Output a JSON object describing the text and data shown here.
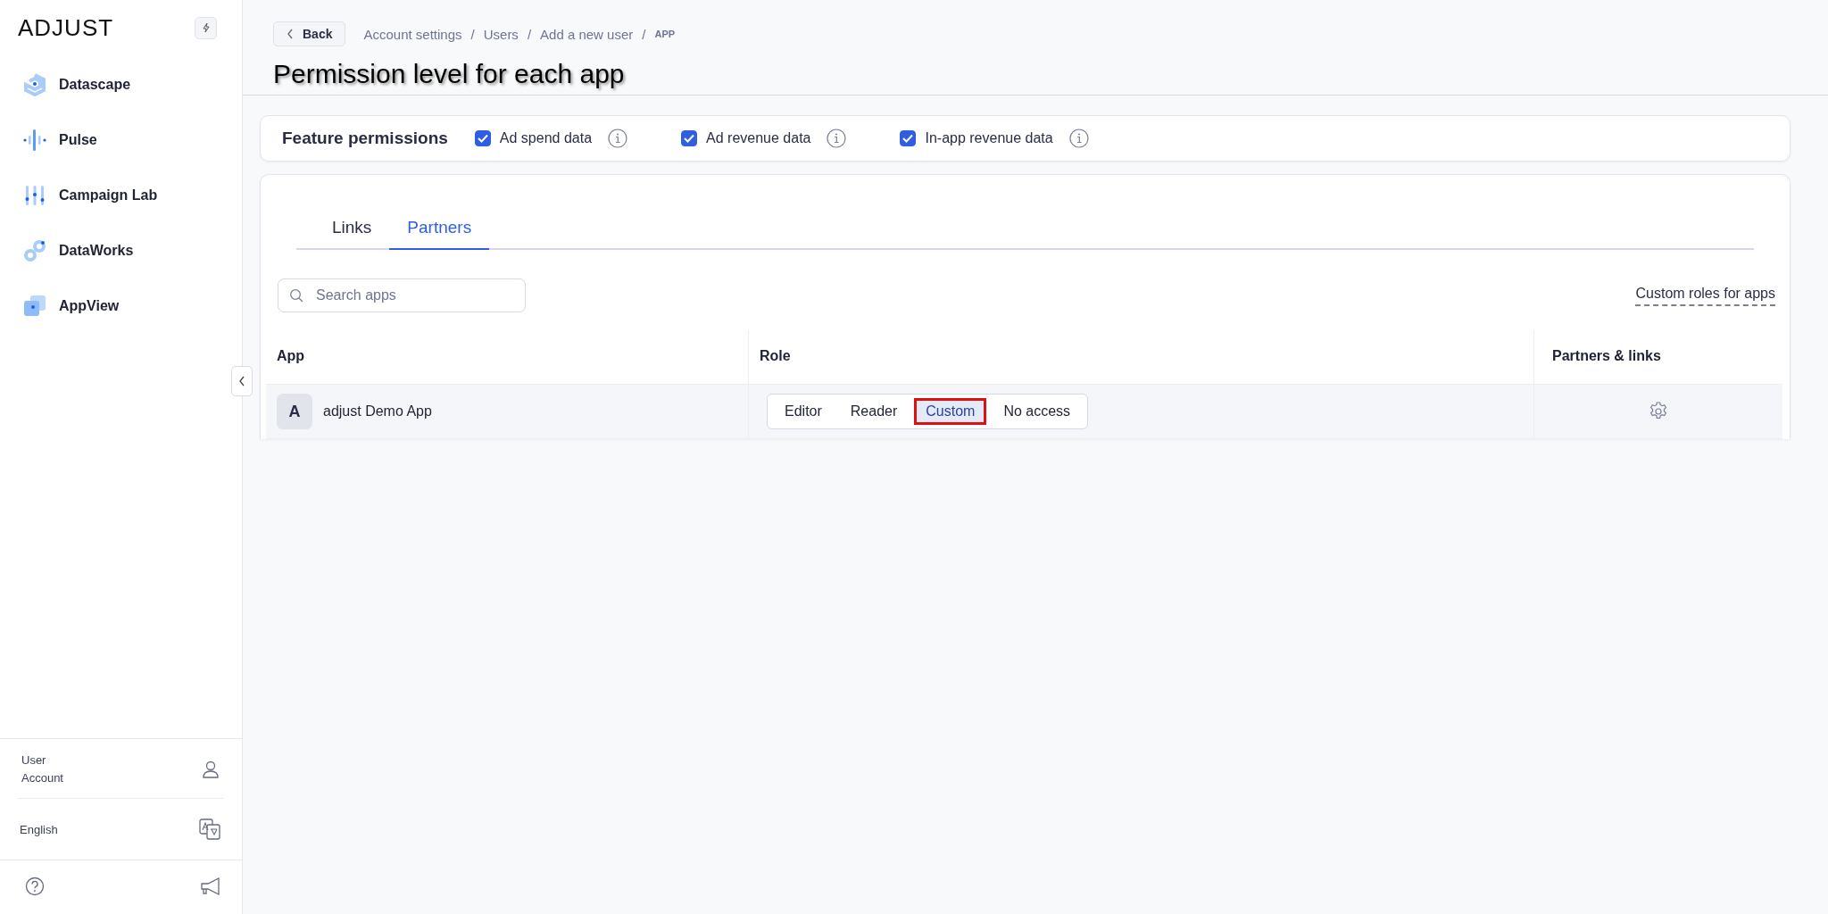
{
  "sidebar": {
    "logo": "ADJUST",
    "items": [
      {
        "label": "Datascape",
        "kind": "datascape"
      },
      {
        "label": "Pulse",
        "kind": "pulse"
      },
      {
        "label": "Campaign Lab",
        "kind": "campaign"
      },
      {
        "label": "DataWorks",
        "kind": "dataworks"
      },
      {
        "label": "AppView",
        "kind": "appview"
      }
    ],
    "account": [
      "User",
      "Account"
    ],
    "language": "English"
  },
  "header": {
    "back": "Back",
    "breadcrumbs": [
      {
        "label": "Account settings",
        "kind": "link"
      },
      {
        "separator": "/",
        "label": "Users",
        "kind": "link"
      },
      {
        "separator": "/",
        "label": "Add a new user",
        "kind": "link"
      },
      {
        "separator": "/",
        "label": "APP",
        "kind": "current"
      }
    ],
    "title": "Permission level for each app"
  },
  "feature_permissions": {
    "title": "Feature permissions",
    "options": [
      {
        "label": "Ad spend data",
        "checked": true
      },
      {
        "label": "Ad revenue data",
        "checked": true
      },
      {
        "label": "In-app revenue data",
        "checked": true
      }
    ]
  },
  "tabs": [
    {
      "label": "Links",
      "selected": false
    },
    {
      "label": "Partners",
      "selected": true
    }
  ],
  "search": {
    "placeholder": "Search apps"
  },
  "custom_roles_link": "Custom roles for apps",
  "table": {
    "columns": [
      "App",
      "Role",
      "Partners & links"
    ],
    "rows": [
      {
        "initial": "A",
        "app": "adjust Demo App",
        "roles": [
          {
            "label": "Editor",
            "selected": false,
            "highlighted": false
          },
          {
            "label": "Reader",
            "selected": false,
            "highlighted": false
          },
          {
            "label": "Custom",
            "selected": true,
            "highlighted": true
          },
          {
            "label": "No access",
            "selected": false,
            "highlighted": false
          }
        ]
      }
    ]
  }
}
